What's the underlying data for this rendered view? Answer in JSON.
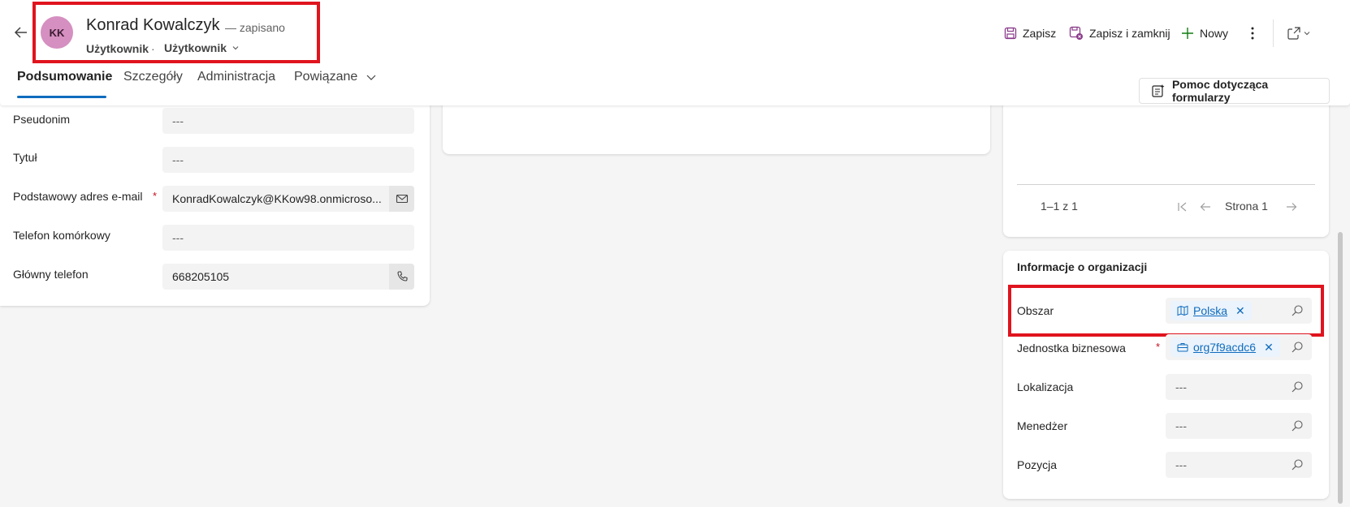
{
  "header": {
    "avatar_initials": "KK",
    "record_name": "Konrad Kowalczyk",
    "save_status": "— zapisano",
    "entity_type": "Użytkownik",
    "separator": "·",
    "form_name": "Użytkownik"
  },
  "commands": {
    "save": "Zapisz",
    "save_close": "Zapisz i zamknij",
    "new": "Nowy"
  },
  "tabs": {
    "summary": "Podsumowanie",
    "details": "Szczegóły",
    "admin": "Administracja",
    "related": "Powiązane"
  },
  "form_help": "Pomoc dotycząca formularzy",
  "left_fields": {
    "nickname": {
      "label": "Pseudonim",
      "value": "---"
    },
    "title": {
      "label": "Tytuł",
      "value": "---"
    },
    "email": {
      "label": "Podstawowy adres e-mail",
      "value": "KonradKowalczyk@KKow98.onmicroso...",
      "required_mark": "*"
    },
    "mobile": {
      "label": "Telefon komórkowy",
      "value": "---"
    },
    "main_phone": {
      "label": "Główny telefon",
      "value": "668205105"
    }
  },
  "subgrid": {
    "count": "1–1 z 1",
    "page": "Strona 1"
  },
  "org_section": {
    "title": "Informacje o organizacji",
    "territory": {
      "label": "Obszar",
      "value": "Polska",
      "remove": "✕"
    },
    "business_unit": {
      "label": "Jednostka biznesowa",
      "value": "org7f9acdc6",
      "remove": "✕",
      "required_mark": "*"
    },
    "site": {
      "label": "Lokalizacja",
      "value": "---"
    },
    "manager": {
      "label": "Menedżer",
      "value": "---"
    },
    "position": {
      "label": "Pozycja",
      "value": "---"
    }
  },
  "colors": {
    "accent": "#0f6cbd",
    "highlight": "#e0141e",
    "avatar": "#d58fc0",
    "save_icon": "#8a3a8a",
    "new_icon": "#107c10"
  }
}
